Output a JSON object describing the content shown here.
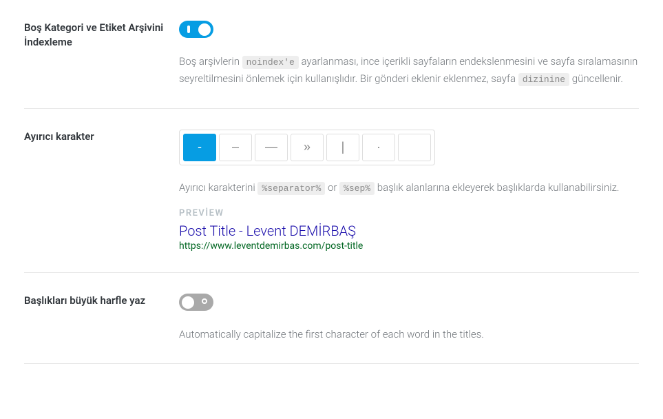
{
  "rows": {
    "noindex": {
      "label": "Boş Kategori ve Etiket Arşivini İndexleme",
      "desc_part1": "Boş arşivlerin ",
      "code1": "noindex'e",
      "desc_part2": " ayarlanması, ince içerikli sayfaların endekslenmesini ve sayfa sıralamasının seyreltilmesini önlemek için kullanışlıdır. Bir gönderi eklenir eklenmez, sayfa ",
      "code2": "dizinine",
      "desc_part3": " güncellenir."
    },
    "separator": {
      "label": "Ayırıcı karakter",
      "options": [
        "-",
        "–",
        "—",
        "»",
        "|",
        "·",
        ""
      ],
      "desc_part1": "Ayırıcı karakterini ",
      "code1": "%separator%",
      "desc_part2": " or ",
      "code2": "%sep%",
      "desc_part3": " başlık alanlarına ekleyerek başlıklarda kullanabilirsiniz.",
      "preview_label": "PREVİEW",
      "preview_title": "Post Title - Levent DEMİRBAŞ",
      "preview_url": "https://www.leventdemirbas.com/post-title"
    },
    "capitalize": {
      "label": "Başlıkları büyük harfle yaz",
      "desc": "Automatically capitalize the first character of each word in the titles."
    }
  }
}
